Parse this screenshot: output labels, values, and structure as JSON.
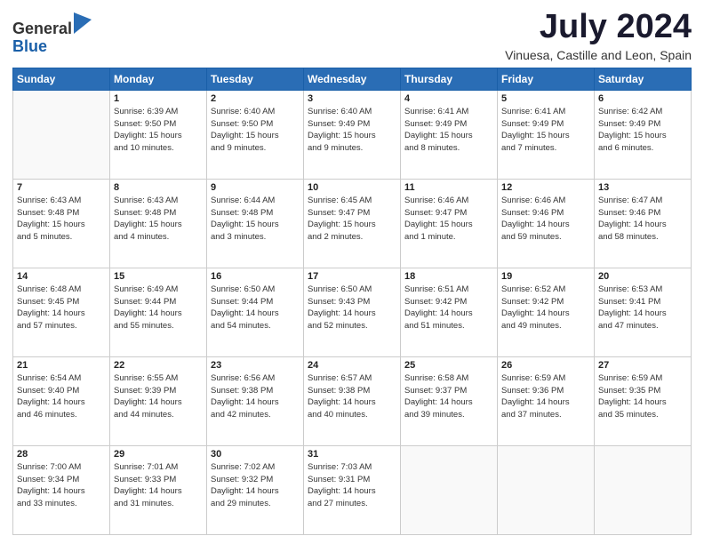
{
  "logo": {
    "general": "General",
    "blue": "Blue"
  },
  "header": {
    "month": "July 2024",
    "location": "Vinuesa, Castille and Leon, Spain"
  },
  "weekdays": [
    "Sunday",
    "Monday",
    "Tuesday",
    "Wednesday",
    "Thursday",
    "Friday",
    "Saturday"
  ],
  "weeks": [
    [
      {
        "day": null,
        "lines": []
      },
      {
        "day": "1",
        "lines": [
          "Sunrise: 6:39 AM",
          "Sunset: 9:50 PM",
          "Daylight: 15 hours",
          "and 10 minutes."
        ]
      },
      {
        "day": "2",
        "lines": [
          "Sunrise: 6:40 AM",
          "Sunset: 9:50 PM",
          "Daylight: 15 hours",
          "and 9 minutes."
        ]
      },
      {
        "day": "3",
        "lines": [
          "Sunrise: 6:40 AM",
          "Sunset: 9:49 PM",
          "Daylight: 15 hours",
          "and 9 minutes."
        ]
      },
      {
        "day": "4",
        "lines": [
          "Sunrise: 6:41 AM",
          "Sunset: 9:49 PM",
          "Daylight: 15 hours",
          "and 8 minutes."
        ]
      },
      {
        "day": "5",
        "lines": [
          "Sunrise: 6:41 AM",
          "Sunset: 9:49 PM",
          "Daylight: 15 hours",
          "and 7 minutes."
        ]
      },
      {
        "day": "6",
        "lines": [
          "Sunrise: 6:42 AM",
          "Sunset: 9:49 PM",
          "Daylight: 15 hours",
          "and 6 minutes."
        ]
      }
    ],
    [
      {
        "day": "7",
        "lines": [
          "Sunrise: 6:43 AM",
          "Sunset: 9:48 PM",
          "Daylight: 15 hours",
          "and 5 minutes."
        ]
      },
      {
        "day": "8",
        "lines": [
          "Sunrise: 6:43 AM",
          "Sunset: 9:48 PM",
          "Daylight: 15 hours",
          "and 4 minutes."
        ]
      },
      {
        "day": "9",
        "lines": [
          "Sunrise: 6:44 AM",
          "Sunset: 9:48 PM",
          "Daylight: 15 hours",
          "and 3 minutes."
        ]
      },
      {
        "day": "10",
        "lines": [
          "Sunrise: 6:45 AM",
          "Sunset: 9:47 PM",
          "Daylight: 15 hours",
          "and 2 minutes."
        ]
      },
      {
        "day": "11",
        "lines": [
          "Sunrise: 6:46 AM",
          "Sunset: 9:47 PM",
          "Daylight: 15 hours",
          "and 1 minute."
        ]
      },
      {
        "day": "12",
        "lines": [
          "Sunrise: 6:46 AM",
          "Sunset: 9:46 PM",
          "Daylight: 14 hours",
          "and 59 minutes."
        ]
      },
      {
        "day": "13",
        "lines": [
          "Sunrise: 6:47 AM",
          "Sunset: 9:46 PM",
          "Daylight: 14 hours",
          "and 58 minutes."
        ]
      }
    ],
    [
      {
        "day": "14",
        "lines": [
          "Sunrise: 6:48 AM",
          "Sunset: 9:45 PM",
          "Daylight: 14 hours",
          "and 57 minutes."
        ]
      },
      {
        "day": "15",
        "lines": [
          "Sunrise: 6:49 AM",
          "Sunset: 9:44 PM",
          "Daylight: 14 hours",
          "and 55 minutes."
        ]
      },
      {
        "day": "16",
        "lines": [
          "Sunrise: 6:50 AM",
          "Sunset: 9:44 PM",
          "Daylight: 14 hours",
          "and 54 minutes."
        ]
      },
      {
        "day": "17",
        "lines": [
          "Sunrise: 6:50 AM",
          "Sunset: 9:43 PM",
          "Daylight: 14 hours",
          "and 52 minutes."
        ]
      },
      {
        "day": "18",
        "lines": [
          "Sunrise: 6:51 AM",
          "Sunset: 9:42 PM",
          "Daylight: 14 hours",
          "and 51 minutes."
        ]
      },
      {
        "day": "19",
        "lines": [
          "Sunrise: 6:52 AM",
          "Sunset: 9:42 PM",
          "Daylight: 14 hours",
          "and 49 minutes."
        ]
      },
      {
        "day": "20",
        "lines": [
          "Sunrise: 6:53 AM",
          "Sunset: 9:41 PM",
          "Daylight: 14 hours",
          "and 47 minutes."
        ]
      }
    ],
    [
      {
        "day": "21",
        "lines": [
          "Sunrise: 6:54 AM",
          "Sunset: 9:40 PM",
          "Daylight: 14 hours",
          "and 46 minutes."
        ]
      },
      {
        "day": "22",
        "lines": [
          "Sunrise: 6:55 AM",
          "Sunset: 9:39 PM",
          "Daylight: 14 hours",
          "and 44 minutes."
        ]
      },
      {
        "day": "23",
        "lines": [
          "Sunrise: 6:56 AM",
          "Sunset: 9:38 PM",
          "Daylight: 14 hours",
          "and 42 minutes."
        ]
      },
      {
        "day": "24",
        "lines": [
          "Sunrise: 6:57 AM",
          "Sunset: 9:38 PM",
          "Daylight: 14 hours",
          "and 40 minutes."
        ]
      },
      {
        "day": "25",
        "lines": [
          "Sunrise: 6:58 AM",
          "Sunset: 9:37 PM",
          "Daylight: 14 hours",
          "and 39 minutes."
        ]
      },
      {
        "day": "26",
        "lines": [
          "Sunrise: 6:59 AM",
          "Sunset: 9:36 PM",
          "Daylight: 14 hours",
          "and 37 minutes."
        ]
      },
      {
        "day": "27",
        "lines": [
          "Sunrise: 6:59 AM",
          "Sunset: 9:35 PM",
          "Daylight: 14 hours",
          "and 35 minutes."
        ]
      }
    ],
    [
      {
        "day": "28",
        "lines": [
          "Sunrise: 7:00 AM",
          "Sunset: 9:34 PM",
          "Daylight: 14 hours",
          "and 33 minutes."
        ]
      },
      {
        "day": "29",
        "lines": [
          "Sunrise: 7:01 AM",
          "Sunset: 9:33 PM",
          "Daylight: 14 hours",
          "and 31 minutes."
        ]
      },
      {
        "day": "30",
        "lines": [
          "Sunrise: 7:02 AM",
          "Sunset: 9:32 PM",
          "Daylight: 14 hours",
          "and 29 minutes."
        ]
      },
      {
        "day": "31",
        "lines": [
          "Sunrise: 7:03 AM",
          "Sunset: 9:31 PM",
          "Daylight: 14 hours",
          "and 27 minutes."
        ]
      },
      {
        "day": null,
        "lines": []
      },
      {
        "day": null,
        "lines": []
      },
      {
        "day": null,
        "lines": []
      }
    ]
  ]
}
